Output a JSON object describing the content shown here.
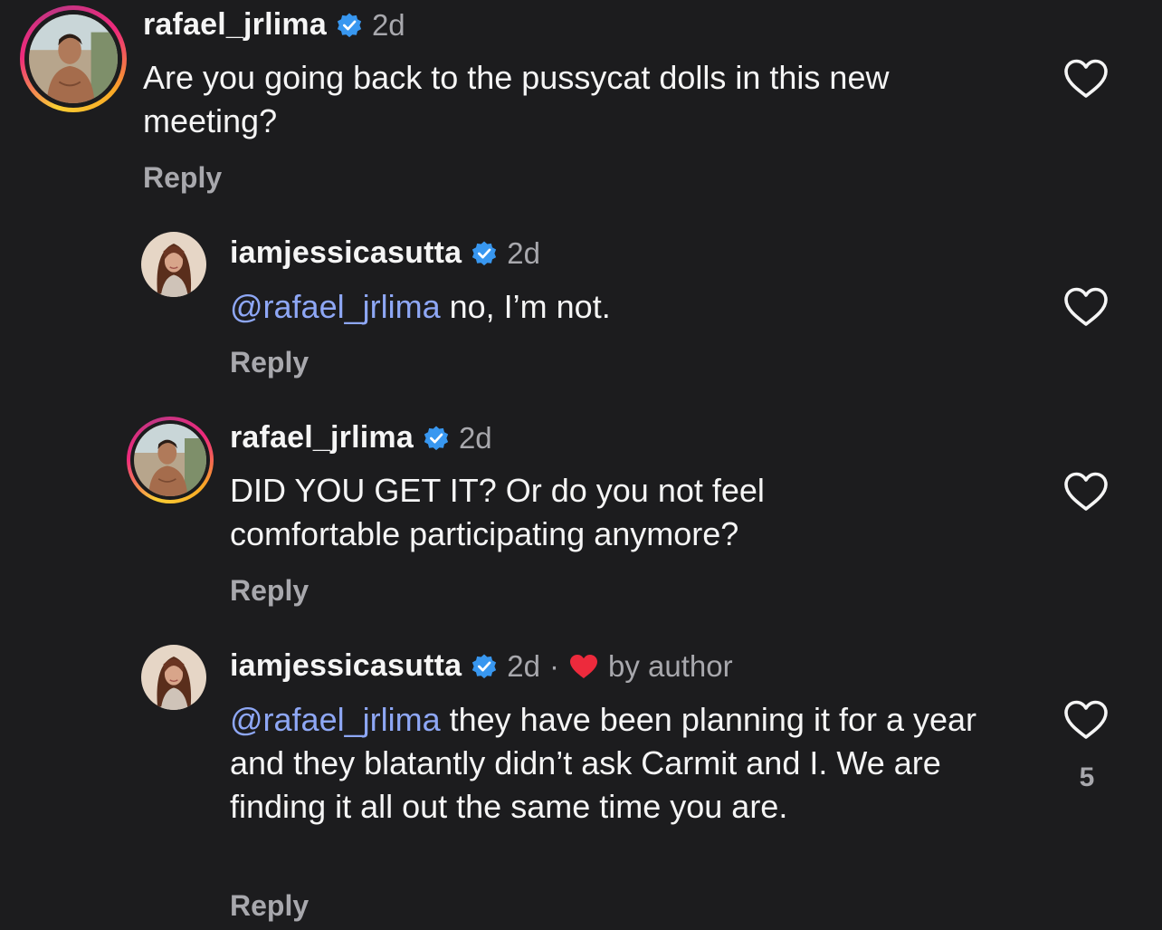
{
  "comments": [
    {
      "username": "rafael_jrlima",
      "time": "2d",
      "text": "Are you going back to the pussycat dolls in this new meeting?",
      "reply_label": "Reply"
    },
    {
      "username": "iamjessicasutta",
      "time": "2d",
      "mention": "@rafael_jrlima",
      "text": " no, I’m not.",
      "reply_label": "Reply"
    },
    {
      "username": "rafael_jrlima",
      "time": "2d",
      "text": "DID YOU GET IT? Or do you not feel comfortable participating anymore?",
      "reply_label": "Reply"
    },
    {
      "username": "iamjessicasutta",
      "time": "2d",
      "separator": "·",
      "liked_by_author_label": "by author",
      "mention": "@rafael_jrlima",
      "text": " they have been planning it for a year and they blatantly didn’t ask Carmit and I. We are finding it all out the same time you are.",
      "reply_label": "Reply",
      "like_count": "5"
    }
  ],
  "colors": {
    "background": "#1c1c1e",
    "mention": "#8ea7f5",
    "verified": "#3897f0",
    "author_heart": "#ed2a3c",
    "secondary_text": "#a8a8ad"
  },
  "icons": {
    "verified": "verified-badge-icon",
    "like": "heart-outline-icon",
    "author_like": "heart-filled-icon"
  }
}
